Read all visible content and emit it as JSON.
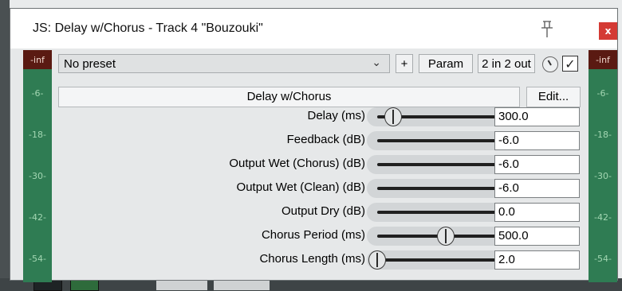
{
  "window": {
    "title": "JS: Delay w/Chorus - Track 4 \"Bouzouki\"",
    "close_label": "x"
  },
  "toolbar": {
    "preset": "No preset",
    "add_label": "+",
    "param_label": "Param",
    "io_label": "2 in 2 out",
    "bypass_checked": true
  },
  "meters": {
    "top_label": "-inf",
    "marks": [
      "-6-",
      "-18-",
      "-30-",
      "-42-",
      "-54-"
    ]
  },
  "plugin": {
    "name": "Delay w/Chorus",
    "edit_label": "Edit..."
  },
  "params": [
    {
      "label": "Delay (ms)",
      "value": "300.0",
      "position": 0.11
    },
    {
      "label": "Feedback (dB)",
      "value": "-6.0",
      "position": 0.87
    },
    {
      "label": "Output Wet (Chorus) (dB)",
      "value": "-6.0",
      "position": 0.87
    },
    {
      "label": "Output Wet (Clean) (dB)",
      "value": "-6.0",
      "position": 0.87
    },
    {
      "label": "Output Dry (dB)",
      "value": "0.0",
      "position": 0.92
    },
    {
      "label": "Chorus Period (ms)",
      "value": "500.0",
      "position": 0.47
    },
    {
      "label": "Chorus Length (ms)",
      "value": "2.0",
      "position": 0.0
    }
  ],
  "colors": {
    "meter_bg": "#2f7c53",
    "meter_top": "#5a1a12",
    "close_bg": "#d43a34"
  }
}
